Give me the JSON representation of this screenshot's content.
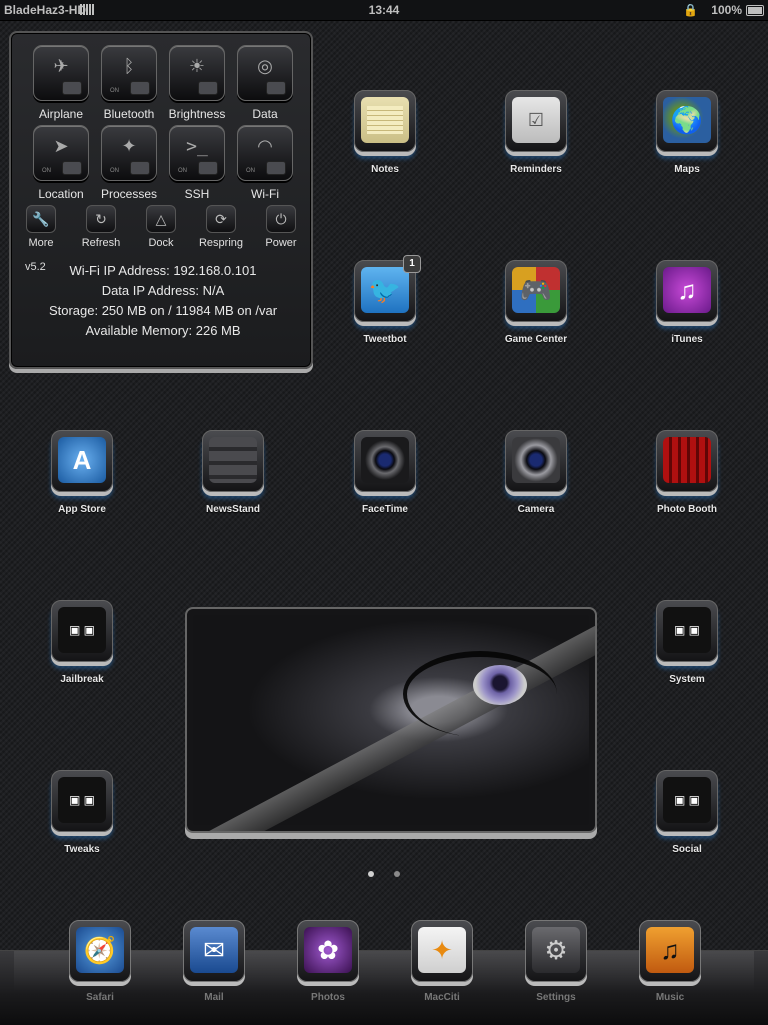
{
  "status_bar": {
    "carrier": "BladeHaz3-HD",
    "time": "13:44",
    "battery": "100%"
  },
  "sbsettings": {
    "toggles": [
      {
        "label": "Airplane",
        "icon": "airplane-icon"
      },
      {
        "label": "Bluetooth",
        "icon": "bluetooth-icon"
      },
      {
        "label": "Brightness",
        "icon": "brightness-icon"
      },
      {
        "label": "Data",
        "icon": "data-icon"
      },
      {
        "label": "Location",
        "icon": "location-icon"
      },
      {
        "label": "Processes",
        "icon": "processes-icon"
      },
      {
        "label": "SSH",
        "icon": "ssh-icon"
      },
      {
        "label": "Wi-Fi",
        "icon": "wifi-icon"
      }
    ],
    "on_text": "ON",
    "actions": [
      {
        "label": "More",
        "icon": "wrench-icon"
      },
      {
        "label": "Refresh",
        "icon": "refresh-icon"
      },
      {
        "label": "Dock",
        "icon": "dock-icon"
      },
      {
        "label": "Respring",
        "icon": "respring-icon"
      },
      {
        "label": "Power",
        "icon": "power-icon"
      }
    ],
    "version": "v5.2",
    "info": [
      "Wi-Fi IP Address: 192.168.0.101",
      "Data IP Address: N/A",
      "Storage: 250 MB on / 11984 MB on /var",
      "Available Memory: 226 MB"
    ]
  },
  "apps": [
    {
      "name": "Notes"
    },
    {
      "name": "Reminders"
    },
    {
      "name": "Maps"
    },
    {
      "name": "Tweetbot",
      "badge": "1"
    },
    {
      "name": "Game Center"
    },
    {
      "name": "iTunes"
    },
    {
      "name": "App Store"
    },
    {
      "name": "NewsStand"
    },
    {
      "name": "FaceTime"
    },
    {
      "name": "Camera"
    },
    {
      "name": "Photo Booth"
    },
    {
      "name": "Jailbreak"
    },
    {
      "name": "System"
    },
    {
      "name": "Tweaks"
    },
    {
      "name": "Social"
    }
  ],
  "dock": [
    {
      "name": "Safari"
    },
    {
      "name": "Mail"
    },
    {
      "name": "Photos"
    },
    {
      "name": "MacCiti"
    },
    {
      "name": "Settings"
    },
    {
      "name": "Music"
    }
  ],
  "colors": {
    "accent_glow": "#2878c8",
    "background": "#1f2023",
    "panel": "#1b1c1e"
  }
}
